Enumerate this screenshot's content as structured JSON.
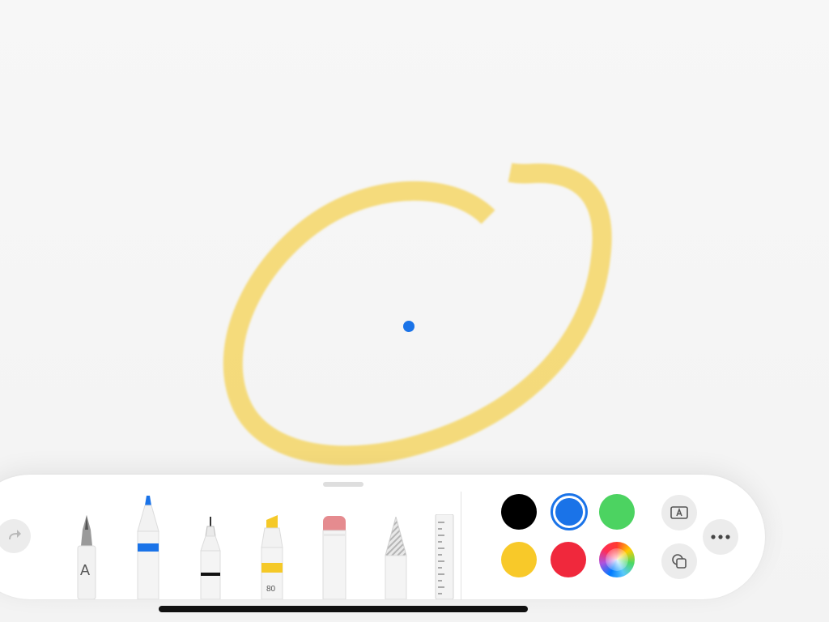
{
  "canvas": {
    "highlighter_stroke_color": "#f5d35a",
    "cursor_dot_color": "#1a73e8"
  },
  "toolbar": {
    "redo_icon": "redo-arrow-icon",
    "tools": [
      {
        "name": "pen",
        "label": "A"
      },
      {
        "name": "marker",
        "accent": "#1a73e8"
      },
      {
        "name": "fineliner"
      },
      {
        "name": "highlighter",
        "label": "80",
        "accent": "#f5c928"
      },
      {
        "name": "eraser",
        "accent": "#e58b8f"
      },
      {
        "name": "pencil"
      },
      {
        "name": "ruler"
      }
    ],
    "colors": [
      {
        "name": "black",
        "hex": "#000000"
      },
      {
        "name": "blue",
        "hex": "#1a73e8",
        "selected": true
      },
      {
        "name": "green",
        "hex": "#4cd361"
      },
      {
        "name": "yellow",
        "hex": "#f8c929"
      },
      {
        "name": "red",
        "hex": "#f0283c"
      },
      {
        "name": "multicolor",
        "hex": "conic"
      }
    ],
    "text_box_icon": "text-box-icon",
    "shapes_icon": "shapes-icon",
    "more_icon": "more-options-icon"
  }
}
